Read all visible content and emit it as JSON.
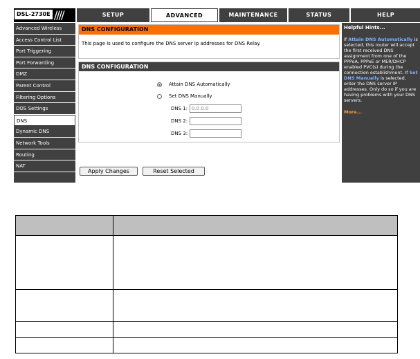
{
  "logo": {
    "model": "DSL-2730E",
    "slashes": "////"
  },
  "nav": {
    "tabs": [
      {
        "label": "SETUP",
        "active": false
      },
      {
        "label": "ADVANCED",
        "active": true
      },
      {
        "label": "MAINTENANCE",
        "active": false
      },
      {
        "label": "STATUS",
        "active": false
      },
      {
        "label": "HELP",
        "active": false
      }
    ]
  },
  "sidebar": {
    "items": [
      "Advanced Wireless",
      "Access Control List",
      "Port Triggering",
      "Port Forwarding",
      "DMZ",
      "Parent Control",
      "Filtering Options",
      "DOS Settings",
      "DNS",
      "Dynamic DNS",
      "Network Tools",
      "Routing",
      "NAT"
    ],
    "active_index": 8
  },
  "info_box": {
    "title": "DNS CONFIGURATION",
    "text": "This page is used to configure the DNS server ip addresses for DNS Relay."
  },
  "config_box": {
    "title": "DNS CONFIGURATION",
    "radio_auto_label": "Attain DNS Automatically",
    "radio_manual_label": "Set DNS Manually",
    "dns1_label": "DNS 1:",
    "dns1_value": "0.0.0.0",
    "dns2_label": "DNS 2:",
    "dns2_value": "",
    "dns3_label": "DNS 3:",
    "dns3_value": ""
  },
  "buttons": {
    "apply": "Apply Changes",
    "reset": "Reset Selected"
  },
  "hints": {
    "title": "Helpful Hints...",
    "p1": "If",
    "p2": "Attain DNS Automatically",
    "p3": "is selected, this router will accept the first received DNS assignment from one of the PPPoA, PPPoE or MER/DHCP enabled PVC(s) during the connection establishment. If",
    "p4": "Set DNS Manually",
    "p5": "is selected, enter the DNS server IP addresses. Only do so if you are having problems with your DNS servers.",
    "more": "More..."
  },
  "colors": {
    "nav_bg": "#404040",
    "info_header": "#ff6f00",
    "hint_link": "#7fb2ff",
    "more_link": "#ff9a3c"
  }
}
